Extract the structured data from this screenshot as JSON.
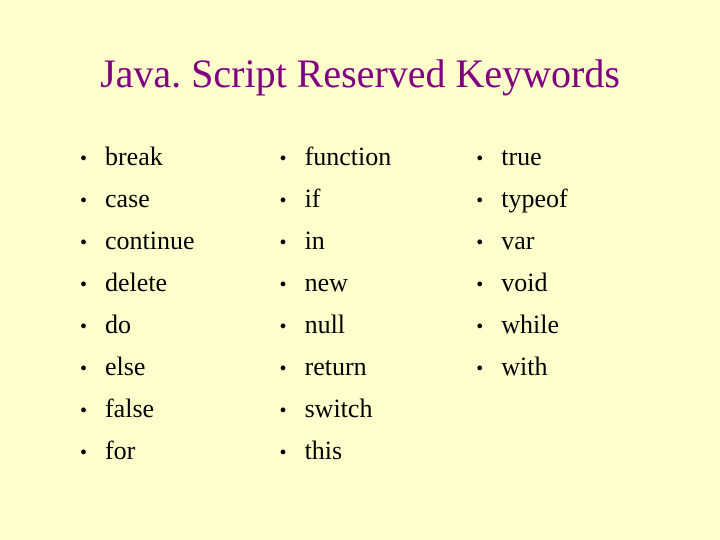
{
  "title": "Java. Script Reserved Keywords",
  "columns": [
    {
      "items": [
        "break",
        "case",
        "continue",
        "delete",
        "do",
        "else",
        "false",
        "for"
      ]
    },
    {
      "items": [
        "function",
        "if",
        "in",
        "new",
        "null",
        "return",
        "switch",
        "this"
      ]
    },
    {
      "items": [
        "true",
        "typeof",
        "var",
        "void",
        "while",
        "with"
      ]
    }
  ]
}
